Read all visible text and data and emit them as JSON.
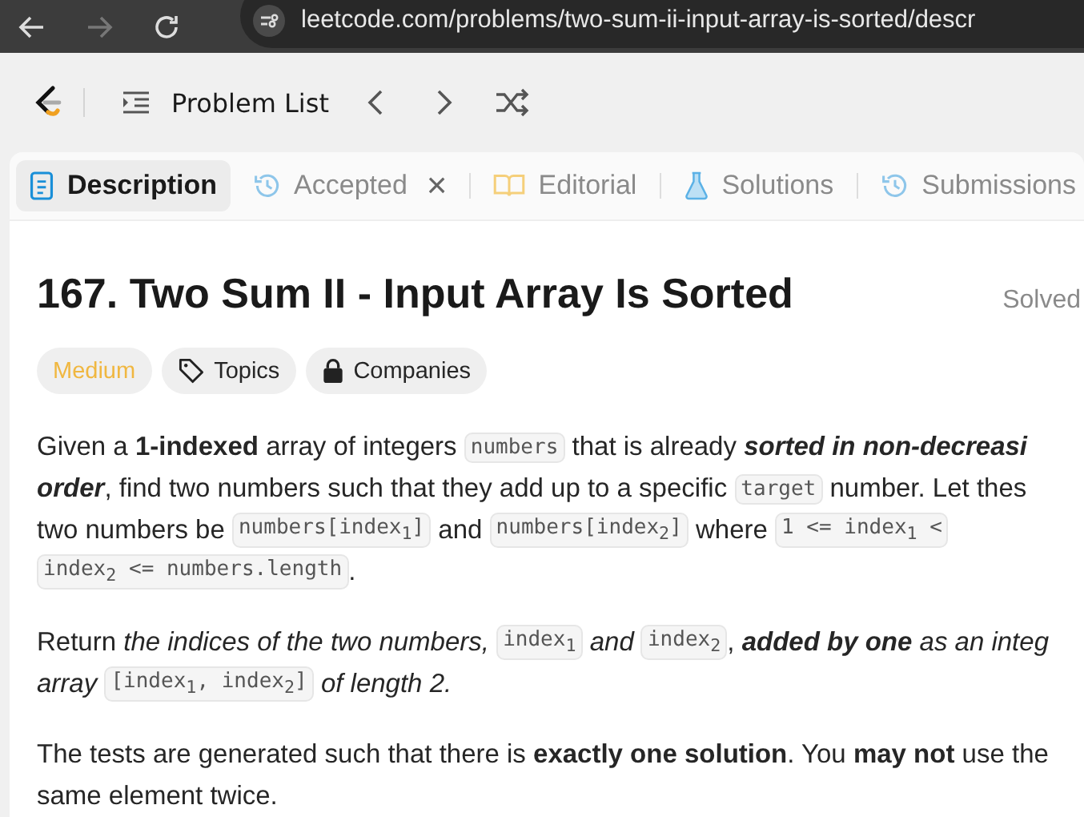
{
  "browser": {
    "url": "leetcode.com/problems/two-sum-ii-input-array-is-sorted/descr"
  },
  "nav": {
    "problem_list": "Problem List"
  },
  "tabs": [
    {
      "label": "Description",
      "kind": "document",
      "selected": true,
      "closable": false
    },
    {
      "label": "Accepted",
      "kind": "history",
      "selected": false,
      "closable": true,
      "close": "×"
    },
    {
      "label": "Editorial",
      "kind": "book",
      "selected": false,
      "closable": false
    },
    {
      "label": "Solutions",
      "kind": "flask",
      "selected": false,
      "closable": false
    },
    {
      "label": "Submissions",
      "kind": "history",
      "selected": false,
      "closable": false
    }
  ],
  "problem": {
    "title": "167. Two Sum II - Input Array Is Sorted",
    "status": "Solved",
    "tags": [
      {
        "label": "Medium",
        "kind": "difficulty"
      },
      {
        "label": "Topics",
        "kind": "topics"
      },
      {
        "label": "Companies",
        "kind": "companies"
      }
    ],
    "paragraphs": [
      [
        [
          {
            "kind": "text",
            "text": "Given a **1-indexed** array of integers "
          },
          {
            "kind": "code",
            "text": "numbers"
          },
          {
            "kind": "text",
            "text": " that is already "
          },
          {
            "kind": "strong-em",
            "text": "sorted in non-decreasi"
          }
        ],
        [
          {
            "kind": "strong-em",
            "text": "order"
          },
          {
            "kind": "text",
            "text": ", find two numbers such that they add up to a specific "
          },
          {
            "kind": "code",
            "text": "target"
          },
          {
            "kind": "text",
            "text": " number. Let thes"
          }
        ],
        [
          {
            "kind": "text",
            "text": "two numbers be "
          },
          {
            "kind": "code",
            "text": "numbers[index$_{1}$]"
          },
          {
            "kind": "text",
            "text": " and "
          },
          {
            "kind": "code",
            "text": "numbers[index$_{2}$]"
          },
          {
            "kind": "text",
            "text": " where "
          },
          {
            "kind": "code",
            "text": "1 <= index$_{1}$ <"
          }
        ],
        [
          {
            "kind": "code",
            "text": "index$_{2}$ <= numbers.length"
          },
          {
            "kind": "text",
            "text": "."
          }
        ]
      ],
      [
        [
          {
            "kind": "text",
            "text": "Return *the indices of the two numbers,* "
          },
          {
            "kind": "code",
            "text": "index$_{1}$"
          },
          {
            "kind": "text",
            "text": " *and* "
          },
          {
            "kind": "code",
            "text": "index$_{2}$"
          },
          {
            "kind": "text",
            "text": ", "
          },
          {
            "kind": "strong-em",
            "text": "added by one"
          },
          {
            "kind": "text",
            "text": " *as an integ*"
          }
        ],
        [
          {
            "kind": "text",
            "text": "*array* "
          },
          {
            "kind": "code",
            "text": "[index$_{1}$, index$_{2}$]"
          },
          {
            "kind": "text",
            "text": " *of length 2.*"
          }
        ]
      ],
      [
        [
          {
            "kind": "text",
            "text": "The tests are generated such that there is **exactly one solution**. You **may not** use the"
          }
        ],
        [
          {
            "kind": "text",
            "text": "same element twice."
          }
        ]
      ]
    ]
  }
}
